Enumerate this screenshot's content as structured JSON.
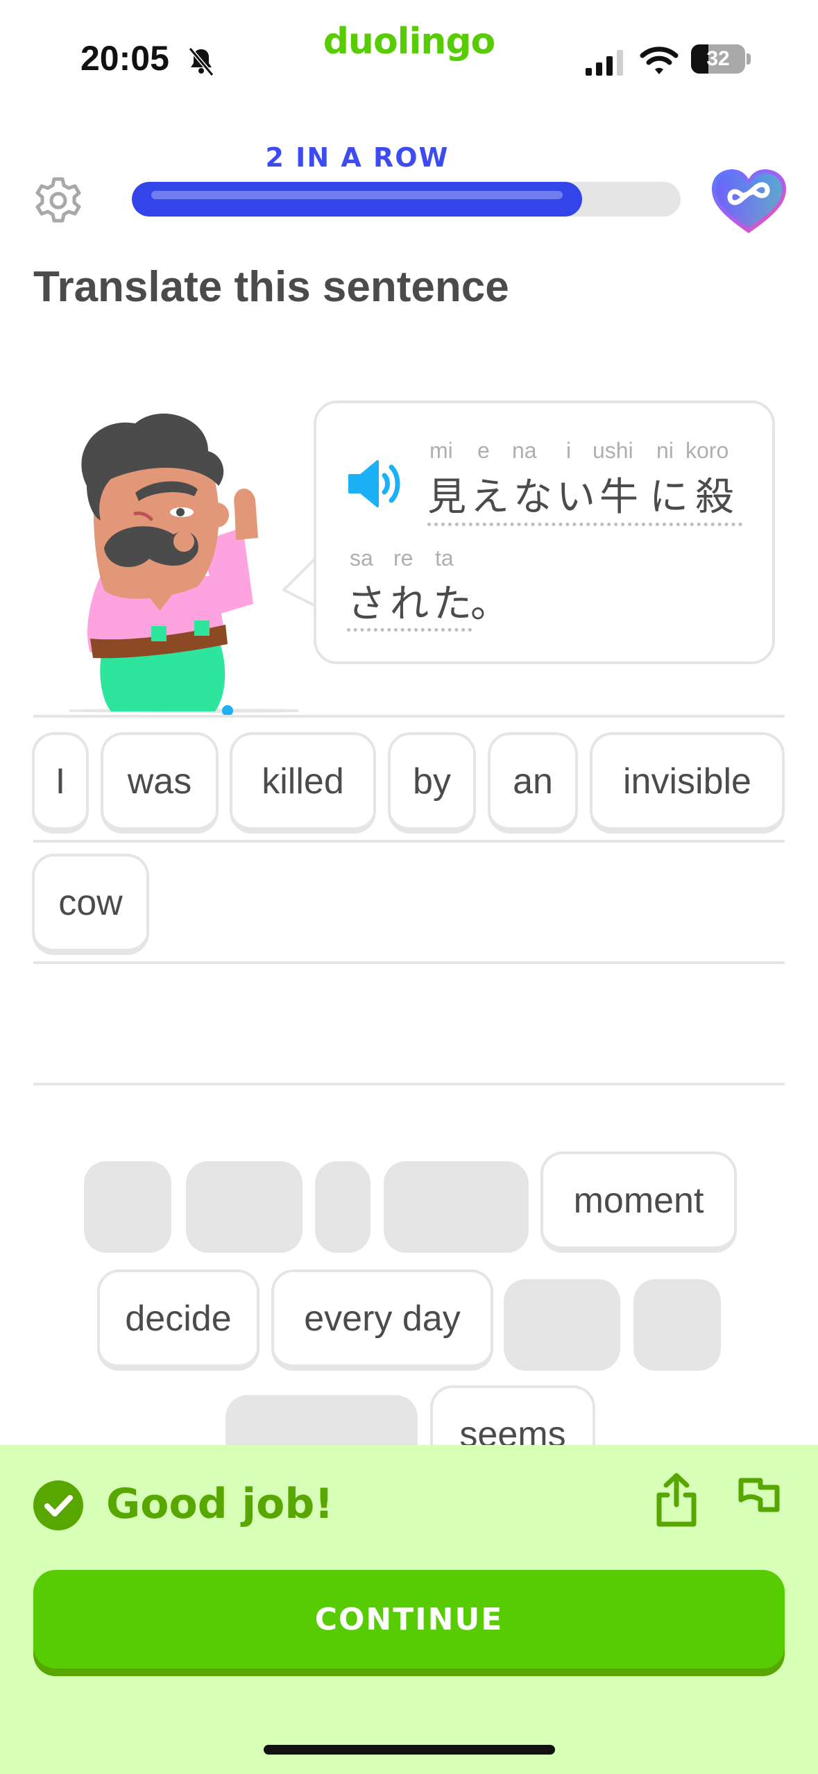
{
  "status_bar": {
    "time": "20:05",
    "battery": "32",
    "battery_level": 0.32
  },
  "brand": "duolingo",
  "header": {
    "streak_label": "2 IN A ROW",
    "progress": 0.82
  },
  "title": "Translate this sentence",
  "prompt": {
    "line1": [
      {
        "kana": "見",
        "ruby": "mi"
      },
      {
        "kana": "え",
        "ruby": "e"
      },
      {
        "kana": "な",
        "ruby": "na"
      },
      {
        "kana": "い",
        "ruby": "i"
      },
      {
        "kana": "牛",
        "ruby": "ushi"
      },
      {
        "kana": "に",
        "ruby": "ni"
      },
      {
        "kana": "殺",
        "ruby": "koro"
      }
    ],
    "line2": [
      {
        "kana": "さ",
        "ruby": "sa"
      },
      {
        "kana": "れ",
        "ruby": "re"
      },
      {
        "kana": "た",
        "ruby": "ta"
      },
      {
        "kana": "。",
        "ruby": ""
      }
    ]
  },
  "answer": [
    "I",
    "was",
    "killed",
    "by",
    "an",
    "invisible",
    "cow"
  ],
  "word_bank": [
    "moment",
    "decide",
    "every day",
    "seems"
  ],
  "feedback": {
    "message": "Good job!",
    "continue_label": "CONTINUE"
  },
  "colors": {
    "brand_green": "#58cc02",
    "streak_blue": "#3345e8",
    "feedback_bg": "#d7ffb8",
    "feedback_text": "#58a700"
  }
}
